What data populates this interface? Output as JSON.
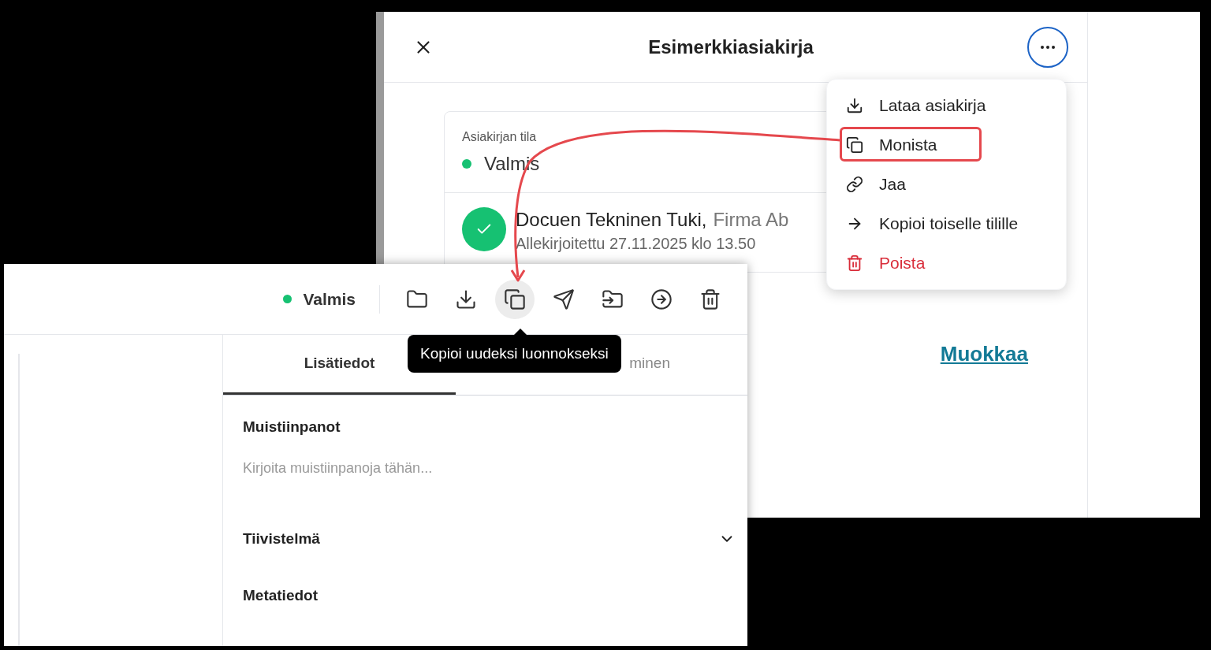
{
  "back_window": {
    "title": "Esimerkkiasiakirja",
    "status_card": {
      "label": "Asiakirjan tila",
      "status": "Valmis",
      "color": "#16c172"
    },
    "signer": {
      "name": "Docuen Tekninen Tuki,",
      "company": "Firma Ab",
      "signed": "Allekirjoitettu 27.11.2025 klo 13.50"
    },
    "edit_link": "Muokkaa",
    "menu": {
      "items": [
        {
          "kind": "download",
          "label": "Lataa asiakirja",
          "annotated": false
        },
        {
          "kind": "copy",
          "label": "Monista",
          "annotated": true
        },
        {
          "kind": "link",
          "label": "Jaa",
          "annotated": false
        },
        {
          "kind": "move",
          "label": "Kopioi toiselle tilille",
          "annotated": false
        },
        {
          "kind": "delete",
          "label": "Poista",
          "annotated": false
        }
      ]
    }
  },
  "front_window": {
    "status": {
      "label": "Valmis",
      "color": "#16c172"
    },
    "toolbar": [
      {
        "kind": "folder",
        "hovered": false
      },
      {
        "kind": "download",
        "hovered": false
      },
      {
        "kind": "copy",
        "hovered": true
      },
      {
        "kind": "send",
        "hovered": false
      },
      {
        "kind": "move",
        "hovered": false
      },
      {
        "kind": "export",
        "hovered": false
      },
      {
        "kind": "delete",
        "hovered": false
      }
    ],
    "tooltip": "Kopioi uudeksi luonnokseksi",
    "tabs": [
      {
        "label": "Lisätiedot",
        "selected": true
      },
      {
        "label": "minen",
        "selected": false
      }
    ],
    "sections": [
      {
        "kind": "notes",
        "title": "Muistiinpanot",
        "placeholder": "Kirjoita muistiinpanoja tähän..."
      },
      {
        "kind": "collapsible",
        "title": "Tiivistelmä",
        "expanded": false
      },
      {
        "kind": "plain",
        "title": "Metatiedot"
      }
    ]
  }
}
